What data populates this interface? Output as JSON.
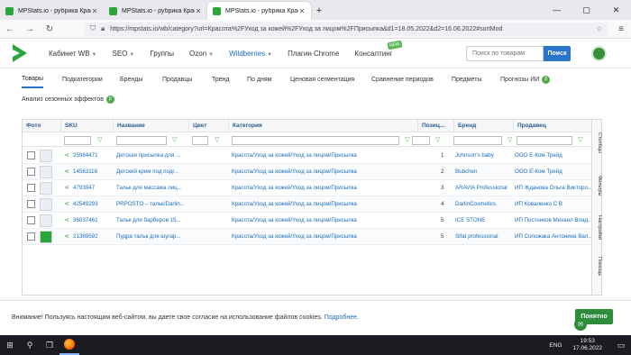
{
  "browser": {
    "tabs": [
      {
        "title": "MPStats.io - рубрика Красота"
      },
      {
        "title": "MPStats.io - рубрика Красота"
      },
      {
        "title": "MPStats.io - рубрика Красота"
      }
    ],
    "url": "https://mpstats.io/wb/category?url=Красота%2FУход за кожей%2FУход за лицом%2FПрисыпка&d1=18.05.2022&d2=16.06.2022#sortMod"
  },
  "header": {
    "nav": [
      {
        "label": "Кабинет WB",
        "chev": true
      },
      {
        "label": "SEO",
        "chev": true
      },
      {
        "label": "Группы",
        "chev": false
      },
      {
        "label": "Ozon",
        "chev": true
      },
      {
        "label": "Wildberries",
        "chev": true
      },
      {
        "label": "Плагин Chrome",
        "chev": false
      },
      {
        "label": "Консалтинг",
        "chev": false
      }
    ],
    "new_badge": "NEW",
    "search_placeholder": "Поиск по товарам",
    "search_button": "Поиск"
  },
  "tabs": [
    {
      "label": "Товары"
    },
    {
      "label": "Подкатегории"
    },
    {
      "label": "Бренды"
    },
    {
      "label": "Продавцы"
    },
    {
      "label": "Тренд"
    },
    {
      "label": "По дням"
    },
    {
      "label": "Ценовая сегментация"
    },
    {
      "label": "Сравнение периодов"
    },
    {
      "label": "Предметы"
    },
    {
      "label": "Прогнозы ИИ"
    }
  ],
  "tab_badge": "β",
  "season_label": "Анализ сезонных эффектов",
  "table": {
    "columns": [
      "Фото",
      "SKU",
      "Название",
      "Цвет",
      "Категория",
      "Позиц...",
      "Бренд",
      "Продавец"
    ],
    "rows": [
      {
        "sku": "25984471",
        "name": "Детская присыпка для ...",
        "category": "Красота/Уход за кожей/Уход за лицом/Присыпка",
        "pos": "1",
        "brand": "Johnson's baby",
        "seller": "ООО Е-Ком Трейд"
      },
      {
        "sku": "14563116",
        "name": "Детский крем под подг...",
        "category": "Красота/Уход за кожей/Уход за лицом/Присыпка",
        "pos": "2",
        "brand": "Bubchen",
        "seller": "ООО Е-Ком Трейд"
      },
      {
        "sku": "4793947",
        "name": "Тальк для массажа лиц...",
        "category": "Красота/Уход за кожей/Уход за лицом/Присыпка",
        "pos": "3",
        "brand": "ARAVIA Professional",
        "seller": "ИП Жданова Ольга Викторо..."
      },
      {
        "sku": "42549293",
        "name": "PRPOSTO – тальк/Darlin...",
        "category": "Красота/Уход за кожей/Уход за лицом/Присыпка",
        "pos": "4",
        "brand": "DarlinCosmetics",
        "seller": "ИП Коваленко С В"
      },
      {
        "sku": "36037461",
        "name": "Тальк для барберов 15...",
        "category": "Красота/Уход за кожей/Уход за лицом/Присыпка",
        "pos": "5",
        "brand": "ICE STONE",
        "seller": "ИП Постников Михаил Влад..."
      },
      {
        "sku": "21369592",
        "name": "Пудра тальк для шугар...",
        "category": "Красота/Уход за кожей/Уход за лицом/Присыпка",
        "pos": "5",
        "brand": "Sifat professional",
        "seller": "ИП Соложака Антонина Вал..."
      }
    ],
    "side_panel": [
      "Столбцы",
      "Фильтры",
      "Настройки",
      "Помощь"
    ]
  },
  "cookie": {
    "text": "Внимание! Пользуясь настоящим веб-сайтом, вы даете свое согласие на использование файлов cookies.",
    "link": "Подробнее.",
    "button": "Понятно"
  },
  "taskbar": {
    "lang": "ENG",
    "time": "19:53",
    "date": "17.06.2022"
  },
  "colors": {
    "accent": "#2874c8",
    "green": "#4caa4c",
    "link": "#1a6dbf"
  }
}
